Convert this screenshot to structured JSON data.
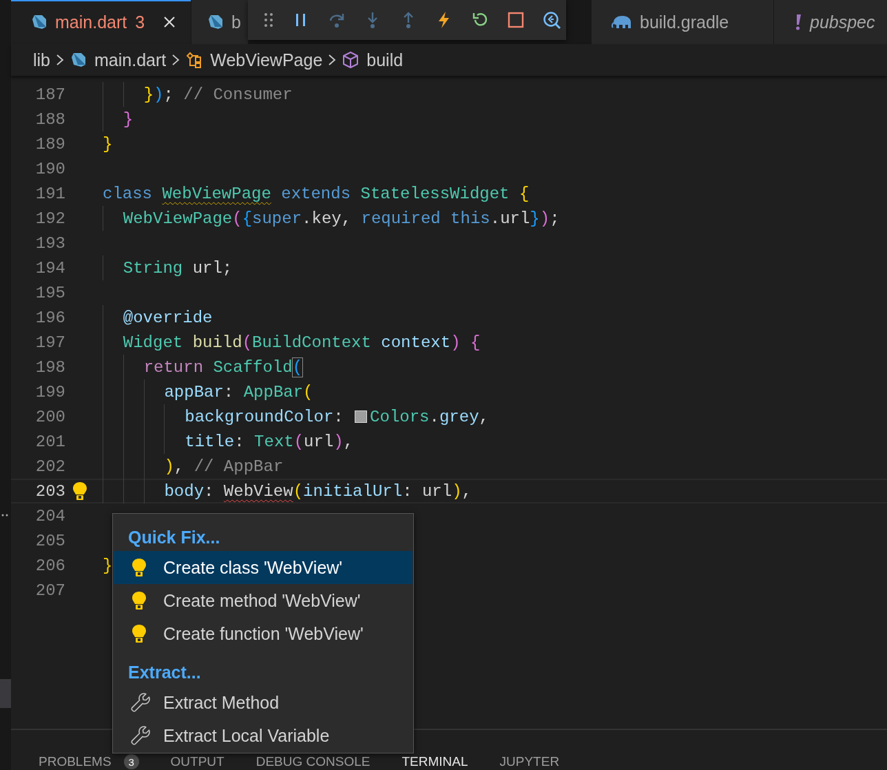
{
  "tabs": [
    {
      "kind": "dart",
      "label": "main.dart",
      "badge": "3",
      "selected": true,
      "error": true,
      "preview": false,
      "closable": true
    },
    {
      "kind": "dart",
      "label": "b",
      "selected": false,
      "error": false,
      "preview": false,
      "closable": false
    },
    {
      "kind": "gradle",
      "label": "build.gradle",
      "selected": false,
      "error": false,
      "preview": false,
      "closable": false
    },
    {
      "kind": "yaml",
      "label": "pubspec",
      "selected": false,
      "error": false,
      "preview": true,
      "closable": false
    }
  ],
  "debug_toolbar": {
    "buttons": [
      {
        "disabled": false
      },
      {
        "disabled": true
      },
      {
        "disabled": true
      },
      {
        "disabled": true
      },
      {
        "disabled": false
      },
      {
        "disabled": false
      },
      {
        "disabled": false
      },
      {
        "disabled": false
      }
    ]
  },
  "breadcrumb": [
    {
      "kind": "folder",
      "label": "lib"
    },
    {
      "kind": "dart",
      "label": "main.dart"
    },
    {
      "kind": "class",
      "label": "WebViewPage"
    },
    {
      "kind": "method",
      "label": "build"
    }
  ],
  "code_lines": [
    {
      "number": "187",
      "current": false,
      "lightbulb": false,
      "tokens": [
        {
          "text": "    }",
          "kind": "b1"
        },
        {
          "text": ")",
          "kind": "b3"
        },
        {
          "text": "; ",
          "kind": "plain"
        },
        {
          "text": "// Consumer",
          "kind": "comment"
        }
      ]
    },
    {
      "number": "188",
      "current": false,
      "lightbulb": false,
      "tokens": [
        {
          "text": "  }",
          "kind": "b2"
        }
      ]
    },
    {
      "number": "189",
      "current": false,
      "lightbulb": false,
      "tokens": [
        {
          "text": "}",
          "kind": "b1"
        }
      ]
    },
    {
      "number": "190",
      "current": false,
      "lightbulb": false
    },
    {
      "number": "191",
      "current": false,
      "lightbulb": false,
      "tokens": [
        {
          "text": "class ",
          "kind": "kw"
        },
        {
          "text": "WebViewPage",
          "kind": "typewarn"
        },
        {
          "text": " extends ",
          "kind": "kw"
        },
        {
          "text": "StatelessWidget",
          "kind": "type"
        },
        {
          "text": " {",
          "kind": "b1"
        }
      ]
    },
    {
      "number": "192",
      "current": false,
      "lightbulb": false,
      "tokens": [
        {
          "text": "  WebViewPage",
          "kind": "type"
        },
        {
          "text": "(",
          "kind": "b2"
        },
        {
          "text": "{",
          "kind": "b3"
        },
        {
          "text": "super",
          "kind": "kw"
        },
        {
          "text": ".key, ",
          "kind": "plain"
        },
        {
          "text": "required this",
          "kind": "kw"
        },
        {
          "text": ".url",
          "kind": "plain"
        },
        {
          "text": "}",
          "kind": "b3"
        },
        {
          "text": ")",
          "kind": "b2"
        },
        {
          "text": ";",
          "kind": "plain"
        }
      ]
    },
    {
      "number": "193",
      "current": false,
      "lightbulb": false
    },
    {
      "number": "194",
      "current": false,
      "lightbulb": false,
      "tokens": [
        {
          "text": "  String",
          "kind": "type"
        },
        {
          "text": " url;",
          "kind": "plain"
        }
      ]
    },
    {
      "number": "195",
      "current": false,
      "lightbulb": false
    },
    {
      "number": "196",
      "current": false,
      "lightbulb": false,
      "tokens": [
        {
          "text": "  @override",
          "kind": "prop"
        }
      ]
    },
    {
      "number": "197",
      "current": false,
      "lightbulb": false,
      "tokens": [
        {
          "text": "  Widget ",
          "kind": "type"
        },
        {
          "text": "build",
          "kind": "fn"
        },
        {
          "text": "(",
          "kind": "b2"
        },
        {
          "text": "BuildContext ",
          "kind": "type"
        },
        {
          "text": "context",
          "kind": "prop"
        },
        {
          "text": ")",
          "kind": "b2"
        },
        {
          "text": " {",
          "kind": "b2"
        }
      ]
    },
    {
      "number": "198",
      "current": false,
      "lightbulb": false,
      "tokens": [
        {
          "text": "    return ",
          "kind": "ctl"
        },
        {
          "text": "Scaffold",
          "kind": "type"
        },
        {
          "text": "(",
          "kind": "b3match"
        }
      ]
    },
    {
      "number": "199",
      "current": false,
      "lightbulb": false,
      "tokens": [
        {
          "text": "      appBar",
          "kind": "prop"
        },
        {
          "text": ": ",
          "kind": "plain"
        },
        {
          "text": "AppBar",
          "kind": "type"
        },
        {
          "text": "(",
          "kind": "b1"
        }
      ]
    },
    {
      "number": "200",
      "current": false,
      "lightbulb": false,
      "tokens": [
        {
          "text": "        backgroundColor",
          "kind": "prop"
        },
        {
          "text": ": ",
          "kind": "plain"
        },
        {
          "kind": "swatch",
          "color": "#9e9e9e"
        },
        {
          "text": "Colors",
          "kind": "type"
        },
        {
          "text": ".",
          "kind": "plain"
        },
        {
          "text": "grey",
          "kind": "prop"
        },
        {
          "text": ",",
          "kind": "plain"
        }
      ]
    },
    {
      "number": "201",
      "current": false,
      "lightbulb": false,
      "tokens": [
        {
          "text": "        title",
          "kind": "prop"
        },
        {
          "text": ": ",
          "kind": "plain"
        },
        {
          "text": "Text",
          "kind": "type"
        },
        {
          "text": "(",
          "kind": "b2"
        },
        {
          "text": "url",
          "kind": "plain"
        },
        {
          "text": ")",
          "kind": "b2"
        },
        {
          "text": ",",
          "kind": "plain"
        }
      ]
    },
    {
      "number": "202",
      "current": false,
      "lightbulb": false,
      "tokens": [
        {
          "text": "      )",
          "kind": "b1"
        },
        {
          "text": ", ",
          "kind": "plain"
        },
        {
          "text": "// AppBar",
          "kind": "comment"
        }
      ]
    },
    {
      "number": "203",
      "current": true,
      "lightbulb": true,
      "tokens": [
        {
          "text": "      body",
          "kind": "prop"
        },
        {
          "text": ": ",
          "kind": "plain"
        },
        {
          "text": "WebView",
          "kind": "plainerror"
        },
        {
          "text": "(",
          "kind": "b1"
        },
        {
          "text": "initialUrl",
          "kind": "prop"
        },
        {
          "text": ": ",
          "kind": "plain"
        },
        {
          "text": "url",
          "kind": "plain"
        },
        {
          "text": ")",
          "kind": "b1"
        },
        {
          "text": ",",
          "kind": "plain"
        }
      ]
    },
    {
      "number": "204",
      "current": false,
      "lightbulb": false
    },
    {
      "number": "205",
      "current": false,
      "lightbulb": false
    },
    {
      "number": "206",
      "current": false,
      "lightbulb": false,
      "tokens": [
        {
          "text": "}",
          "kind": "b1"
        }
      ]
    },
    {
      "number": "207",
      "current": false,
      "lightbulb": false
    }
  ],
  "quick_fix_menu": {
    "items": [
      {
        "kind": "header",
        "label": "Quick Fix..."
      },
      {
        "kind": "fix",
        "label": "Create class 'WebView'",
        "selected": true
      },
      {
        "kind": "fix",
        "label": "Create method 'WebView'",
        "selected": false
      },
      {
        "kind": "fix",
        "label": "Create function 'WebView'",
        "selected": false
      },
      {
        "kind": "header",
        "label": "Extract..."
      },
      {
        "kind": "refactor",
        "label": "Extract Method",
        "selected": false
      },
      {
        "kind": "refactor",
        "label": "Extract Local Variable",
        "selected": false
      }
    ]
  },
  "panel_tabs": [
    {
      "label": "PROBLEMS",
      "badge": "3",
      "selected": false
    },
    {
      "label": "OUTPUT",
      "selected": false
    },
    {
      "label": "DEBUG CONSOLE",
      "selected": false
    },
    {
      "label": "TERMINAL",
      "selected": true
    },
    {
      "label": "JUPYTER",
      "selected": false
    }
  ]
}
